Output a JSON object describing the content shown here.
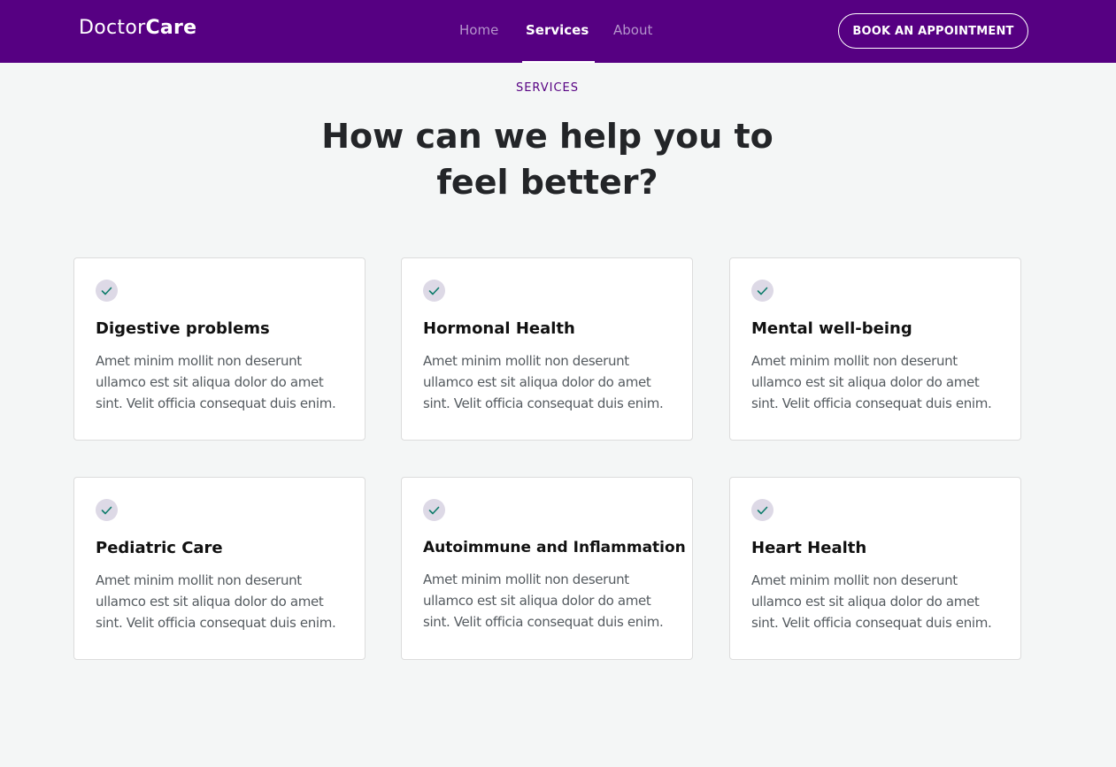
{
  "header": {
    "logo_light": "Doctor",
    "logo_bold": "Care",
    "nav": [
      {
        "label": "Home"
      },
      {
        "label": "Services"
      },
      {
        "label": "About"
      }
    ],
    "cta_label": "BOOK AN APPOINTMENT"
  },
  "section": {
    "eyebrow": "SERVICES",
    "title_line1": "How can we help you to",
    "title_line2": "feel better?"
  },
  "services": [
    {
      "title": "Digestive problems",
      "text": "Amet minim mollit non deserunt ullamco est sit aliqua dolor do amet sint. Velit officia consequat duis enim.",
      "icon": "check-icon"
    },
    {
      "title": "Hormonal Health",
      "text": "Amet minim mollit non deserunt ullamco est sit aliqua dolor do amet sint. Velit officia consequat duis enim.",
      "icon": "check-icon"
    },
    {
      "title": "Mental well-being",
      "text": "Amet minim mollit non deserunt ullamco est sit aliqua dolor do amet sint. Velit officia consequat duis enim.",
      "icon": "check-icon"
    },
    {
      "title": "Pediatric Care",
      "text": "Amet minim mollit non deserunt ullamco est sit aliqua dolor do amet sint. Velit officia consequat duis enim.",
      "icon": "check-icon"
    },
    {
      "title": "Autoimmune and Inflammation",
      "text": "Amet minim mollit non deserunt ullamco est sit aliqua dolor do amet sint. Velit officia consequat duis enim.",
      "icon": "check-icon"
    },
    {
      "title": "Heart Health",
      "text": "Amet minim mollit non deserunt ullamco est sit aliqua dolor do amet sint. Velit officia consequat duis enim.",
      "icon": "check-icon"
    }
  ],
  "colors": {
    "brand": "#560082",
    "background": "#f4f6f6",
    "check": "#0e7c6b",
    "badge": "#ddd9e6"
  }
}
